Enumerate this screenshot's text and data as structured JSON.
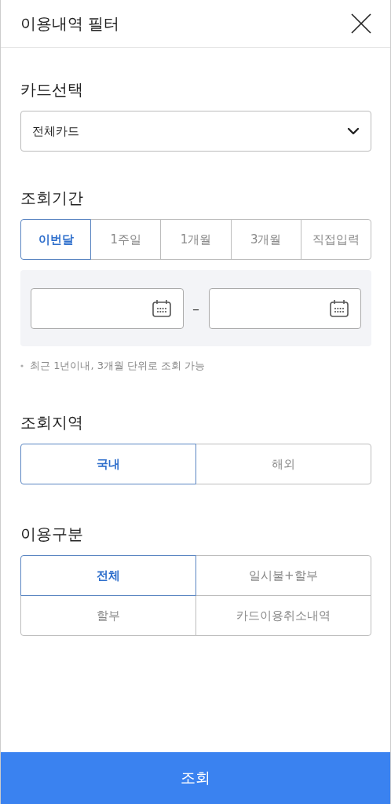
{
  "header": {
    "title": "이용내역 필터"
  },
  "card_select": {
    "label": "카드선택",
    "value": "전체카드"
  },
  "period": {
    "label": "조회기간",
    "options": [
      {
        "label": "이번달",
        "selected": true
      },
      {
        "label": "1주일",
        "selected": false
      },
      {
        "label": "1개월",
        "selected": false
      },
      {
        "label": "3개월",
        "selected": false
      },
      {
        "label": "직접입력",
        "selected": false
      }
    ],
    "range_separator": "–",
    "note": "최근 1년이내, 3개월 단위로 조회 가능"
  },
  "region": {
    "label": "조회지역",
    "options": [
      {
        "label": "국내",
        "selected": true
      },
      {
        "label": "해외",
        "selected": false
      }
    ]
  },
  "usage_type": {
    "label": "이용구분",
    "options": [
      {
        "label": "전체",
        "selected": true
      },
      {
        "label": "일시불+할부",
        "selected": false
      },
      {
        "label": "할부",
        "selected": false
      },
      {
        "label": "카드이용취소내역",
        "selected": false
      }
    ]
  },
  "submit_button": "조회"
}
